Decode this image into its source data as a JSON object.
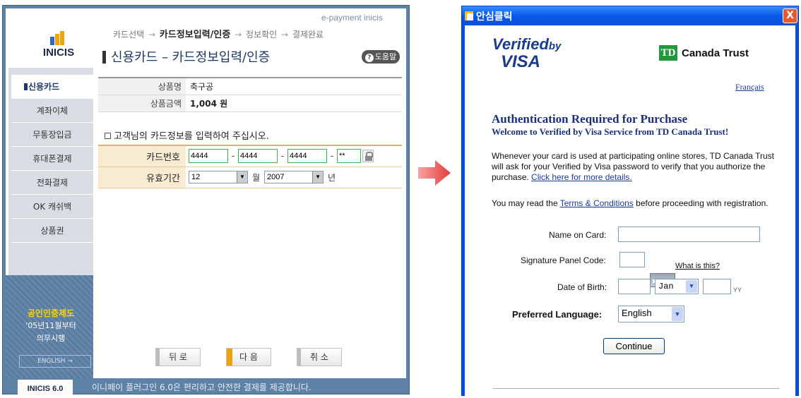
{
  "left": {
    "logo": "INICIS",
    "eyebrow": "e-payment inicis",
    "steps": [
      "카드선택",
      "카드정보입력/인증",
      "정보확인",
      "결제완료"
    ],
    "step_arrow": "→",
    "title": "신용카드 – 카드정보입력/인증",
    "help": "도움말",
    "sidebar": [
      "신용카드",
      "계좌이체",
      "무통장입금",
      "휴대폰결제",
      "전화결제",
      "OK 캐쉬백",
      "상품권"
    ],
    "product_label": "상품명",
    "product_value": "축구공",
    "amount_label": "상품금액",
    "amount_value": "1,004 원",
    "prompt": "고객님의 카드정보를 입력하여 주십시오.",
    "card_label": "카드번호",
    "card_parts": [
      "4444",
      "4444",
      "4444",
      "**"
    ],
    "dash": "-",
    "expiry_label": "유효기간",
    "expiry_month": "12",
    "month_unit": "월",
    "expiry_year": "2007",
    "year_unit": "년",
    "cert_title": "공인인증제도",
    "cert_line1": "'05년11월부터",
    "cert_line2": "의무시행",
    "english_btn": "ENGLISH →",
    "version": "INICIS 6.0",
    "buttons": [
      "뒤 로",
      "다 음",
      "취 소"
    ],
    "footer": "이니페이 플러그인 6.0은 편리하고 안전한 결제를 제공합니다."
  },
  "window": {
    "title": "안심클릭",
    "close": "X",
    "vbv_line1": "Verified",
    "vbv_by": "by",
    "vbv_line2": "VISA",
    "td_box": "TD",
    "td_name": "Canada Trust",
    "francais": "Français",
    "heading": "Authentication Required for Purchase",
    "subheading": "Welcome to Verified by Visa Service from TD Canada Trust!",
    "para1": "Whenever your card is used at participating online stores, TD Canada Trust will ask for your Verified by Visa password to verify that you authorize the purchase.",
    "para1_link": "Click here for more details.",
    "para2_pre": "You may read the",
    "para2_link": "Terms & Conditions",
    "para2_post": "before proceeding with registration.",
    "name_label": "Name on Card:",
    "sig_label": "Signature Panel Code:",
    "whatis": "What is this?",
    "dob_label": "Date of Birth:",
    "dob_month": "Jan",
    "yy": "YY",
    "lang_label": "Preferred Language:",
    "lang_value": "English",
    "continue": "Continue"
  }
}
